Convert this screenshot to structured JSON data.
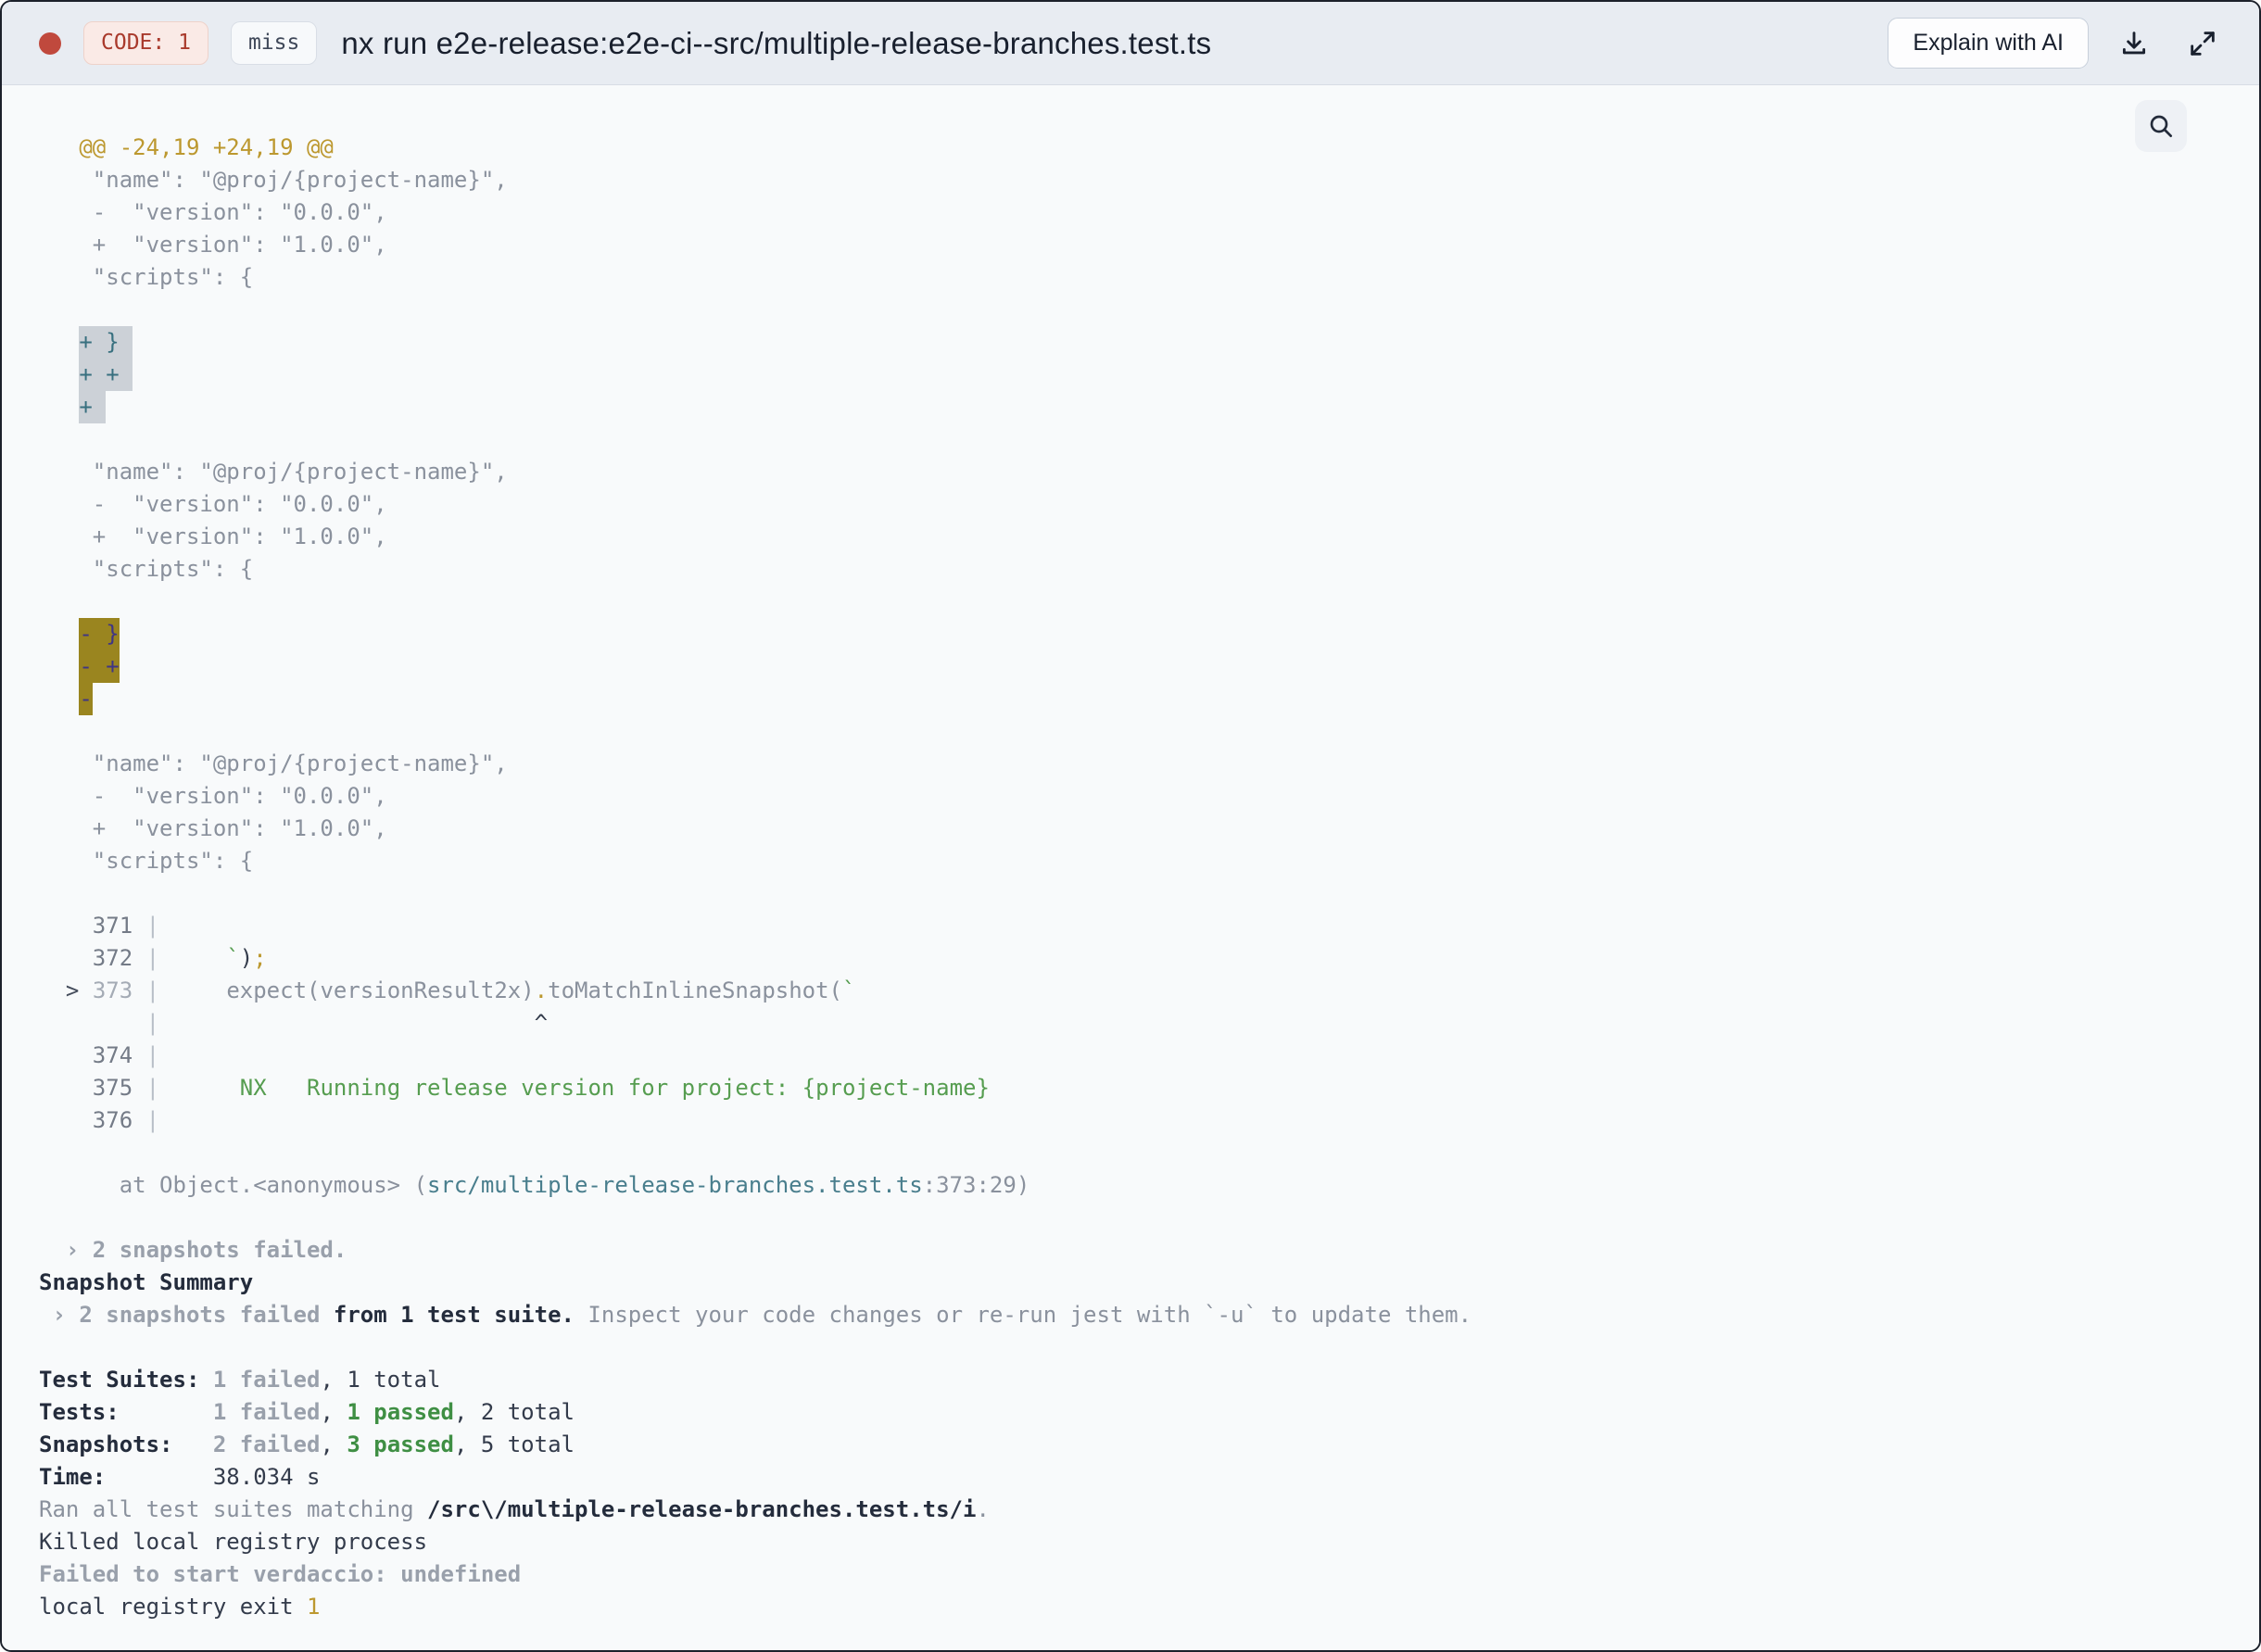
{
  "header": {
    "exit_badge": "CODE: 1",
    "cache_badge": "miss",
    "title": "nx run e2e-release:e2e-ci--src/multiple-release-branches.test.ts",
    "explain_button": "Explain with AI"
  },
  "colors": {
    "accent-red": "#c0493d",
    "code-badge-bg": "#faeae6",
    "code-badge-border": "#eed2ca",
    "code-badge-fg": "#a93a2c",
    "miss-badge-bg": "#f7f9fb",
    "miss-badge-border": "#d9dee6",
    "miss-badge-fg": "#3f4859",
    "title-fg": "#19202e",
    "col-dim": "#8a919d",
    "col-yellow": "#bc982f",
    "col-green": "#569d50",
    "col-green-bold": "#3f8f44",
    "col-teal": "#497e8d",
    "col-dark": "#333b4b",
    "col-bold-dark": "#242c3c",
    "col-bold-gray": "#99a0ab",
    "col-num": "#747b87",
    "col-num-dim": "#a4abb5",
    "col-pipe": "#b8bec7",
    "col-arrow": "#454d5c",
    "hl1-bg": "#ccd1d7",
    "hl1-fg": "#38707f",
    "hl2-bg": "#9a851f",
    "hl2-fg": "#3f3585"
  },
  "terminal": {
    "lines": [
      [
        [
          "   @@ -24,19 +24,19 @@",
          "y"
        ]
      ],
      [
        [
          "    \"name\": \"@proj/{project-name}\",",
          ""
        ]
      ],
      [
        [
          "    -  \"version\": \"0.0.0\",",
          ""
        ]
      ],
      [
        [
          "    +  \"version\": \"1.0.0\",",
          ""
        ]
      ],
      [
        [
          "    \"scripts\": {",
          ""
        ]
      ],
      [],
      [
        [
          "   ",
          ""
        ],
        [
          "+ } ",
          "h1"
        ]
      ],
      [
        [
          "   ",
          ""
        ],
        [
          "+ + ",
          "h1"
        ]
      ],
      [
        [
          "   ",
          ""
        ],
        [
          "+ ",
          "h1"
        ]
      ],
      [],
      [
        [
          "    \"name\": \"@proj/{project-name}\",",
          ""
        ]
      ],
      [
        [
          "    -  \"version\": \"0.0.0\",",
          ""
        ]
      ],
      [
        [
          "    +  \"version\": \"1.0.0\",",
          ""
        ]
      ],
      [
        [
          "    \"scripts\": {",
          ""
        ]
      ],
      [],
      [
        [
          "   ",
          ""
        ],
        [
          "- }",
          "h2"
        ]
      ],
      [
        [
          "   ",
          ""
        ],
        [
          "- +",
          "h2"
        ]
      ],
      [
        [
          "   ",
          ""
        ],
        [
          "-",
          "h2"
        ]
      ],
      [],
      [
        [
          "    \"name\": \"@proj/{project-name}\",",
          ""
        ]
      ],
      [
        [
          "    -  \"version\": \"0.0.0\",",
          ""
        ]
      ],
      [
        [
          "    +  \"version\": \"1.0.0\",",
          ""
        ]
      ],
      [
        [
          "    \"scripts\": {",
          ""
        ]
      ],
      [],
      [
        [
          "    371",
          "n"
        ],
        [
          " |",
          "p"
        ]
      ],
      [
        [
          "    372",
          "n"
        ],
        [
          " |",
          "p"
        ],
        [
          "     ",
          ""
        ],
        [
          "`",
          "g"
        ],
        [
          ")",
          "d"
        ],
        [
          ";",
          "y"
        ]
      ],
      [
        [
          "  ",
          ""
        ],
        [
          ">",
          "a"
        ],
        [
          " ",
          ""
        ],
        [
          "373",
          "nd"
        ],
        [
          " |",
          "p"
        ],
        [
          "     ",
          ""
        ],
        [
          "expect(versionResult2x)",
          ""
        ],
        [
          ".",
          "y"
        ],
        [
          "toMatchInlineSnapshot(",
          ""
        ],
        [
          "`",
          "g"
        ]
      ],
      [
        [
          "        ",
          ""
        ],
        [
          "|",
          "p"
        ],
        [
          "                            ",
          ""
        ],
        [
          "^",
          "d"
        ]
      ],
      [
        [
          "    374",
          "n"
        ],
        [
          " |",
          "p"
        ]
      ],
      [
        [
          "    375",
          "n"
        ],
        [
          " |",
          "p"
        ],
        [
          "      ",
          ""
        ],
        [
          "NX   Running release version for project: {project-name}",
          "g"
        ]
      ],
      [
        [
          "    376",
          "n"
        ],
        [
          " |",
          "p"
        ]
      ],
      [],
      [
        [
          "      at Object.<anonymous> (",
          ""
        ],
        [
          "src/multiple-release-branches.test.ts",
          "t"
        ],
        [
          ":373:29",
          ""
        ],
        [
          ")",
          ""
        ]
      ],
      [],
      [
        [
          "  › 2 snapshots failed.",
          "bgr"
        ]
      ],
      [
        [
          "Snapshot Summary",
          "bd"
        ]
      ],
      [
        [
          " › 2 snapshots failed",
          "bgr"
        ],
        [
          " from 1 test suite.",
          "bd"
        ],
        [
          " Inspect your code changes or re-run jest with `-u` to update them.",
          ""
        ]
      ],
      [],
      [
        [
          "Test Suites: ",
          "bd"
        ],
        [
          "1 failed",
          "bgr"
        ],
        [
          ", 1 total",
          "d"
        ]
      ],
      [
        [
          "Tests:       ",
          "bd"
        ],
        [
          "1 failed",
          "bgr"
        ],
        [
          ", ",
          "d"
        ],
        [
          "1 passed",
          "bg"
        ],
        [
          ", 2 total",
          "d"
        ]
      ],
      [
        [
          "Snapshots:   ",
          "bd"
        ],
        [
          "2 failed",
          "bgr"
        ],
        [
          ", ",
          "d"
        ],
        [
          "3 passed",
          "bg"
        ],
        [
          ", 5 total",
          "d"
        ]
      ],
      [
        [
          "Time:        ",
          "bd"
        ],
        [
          "38.034 s",
          "d"
        ]
      ],
      [
        [
          "Ran all test suites matching ",
          ""
        ],
        [
          "/src\\/multiple-release-branches.test.ts/i",
          "bd"
        ],
        [
          ".",
          ""
        ]
      ],
      [
        [
          "Killed local registry process",
          "d"
        ]
      ],
      [
        [
          "Failed to start verdaccio: undefined",
          "bgr"
        ]
      ],
      [
        [
          "local registry exit ",
          "d"
        ],
        [
          "1",
          "y"
        ]
      ]
    ]
  }
}
